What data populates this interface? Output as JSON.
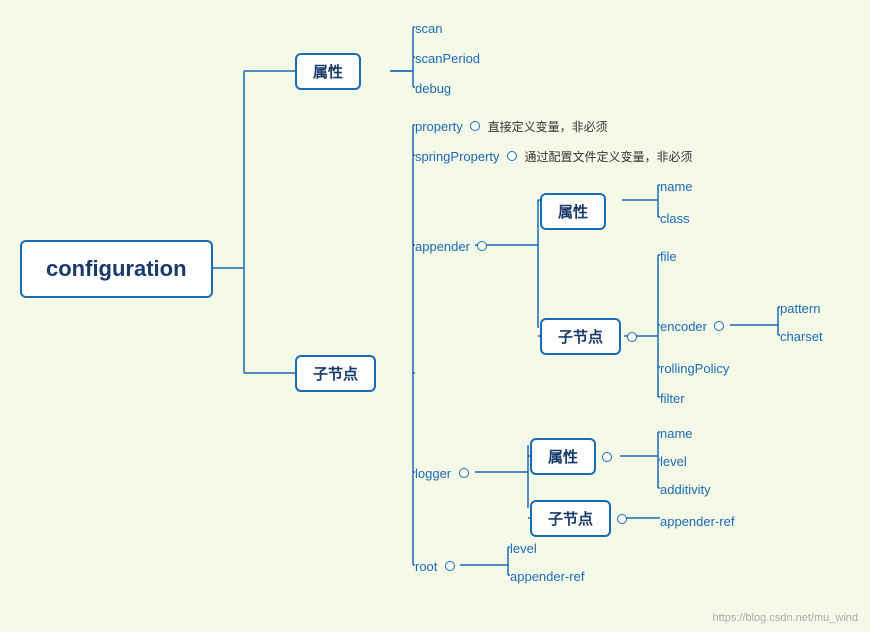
{
  "root_node": {
    "label": "configuration"
  },
  "level1": {
    "attributes": "属性",
    "children": "子节点"
  },
  "attributes_children": [
    "scan",
    "scanPeriod",
    "debug"
  ],
  "property": {
    "label": "property",
    "circle": true,
    "desc": "直接定义变量，非必须"
  },
  "springProperty": {
    "label": "springProperty",
    "circle": true,
    "desc": "通过配置文件定义变量，非必须"
  },
  "appender": {
    "label": "appender",
    "circle": true,
    "attributes": "属性",
    "attr_children": [
      "name",
      "class"
    ],
    "children_label": "子节点",
    "children_circle": true,
    "children": [
      "file"
    ],
    "encoder_label": "encoder",
    "encoder_circle": true,
    "encoder_children": [
      "pattern",
      "charset"
    ],
    "more_children": [
      "rollingPolicy",
      "filter"
    ]
  },
  "logger": {
    "label": "logger",
    "circle": true,
    "attributes": "属性",
    "attr_circle": true,
    "attr_children": [
      "name",
      "level",
      "additivity"
    ],
    "children_label": "子节点",
    "children_circle": true,
    "children": [
      "appender-ref"
    ]
  },
  "root": {
    "label": "root",
    "circle": true,
    "children": [
      "level",
      "appender-ref"
    ]
  },
  "watermark": "https://blog.csdn.net/mu_wind"
}
